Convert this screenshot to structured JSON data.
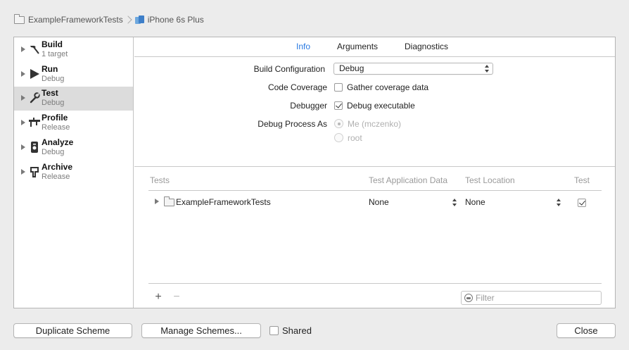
{
  "breadcrumb": {
    "project": "ExampleFrameworkTests",
    "device": "iPhone 6s Plus"
  },
  "sidebar": {
    "items": [
      {
        "name": "Build",
        "sub": "1 target",
        "icon": "hammer-icon",
        "selected": false
      },
      {
        "name": "Run",
        "sub": "Debug",
        "icon": "play-icon",
        "selected": false
      },
      {
        "name": "Test",
        "sub": "Debug",
        "icon": "wrench-icon",
        "selected": true
      },
      {
        "name": "Profile",
        "sub": "Release",
        "icon": "caliper-icon",
        "selected": false
      },
      {
        "name": "Analyze",
        "sub": "Debug",
        "icon": "analyze-icon",
        "selected": false
      },
      {
        "name": "Archive",
        "sub": "Release",
        "icon": "archive-icon",
        "selected": false
      }
    ]
  },
  "tabs": [
    {
      "label": "Info",
      "active": true
    },
    {
      "label": "Arguments",
      "active": false
    },
    {
      "label": "Diagnostics",
      "active": false
    }
  ],
  "form": {
    "build_config_label": "Build Configuration",
    "build_config_value": "Debug",
    "code_coverage_label": "Code Coverage",
    "code_coverage_option": "Gather coverage data",
    "code_coverage_checked": false,
    "debugger_label": "Debugger",
    "debugger_option": "Debug executable",
    "debugger_checked": true,
    "debug_process_label": "Debug Process As",
    "debug_process_options": [
      "Me (mczenko)",
      "root"
    ],
    "debug_process_selected": 0
  },
  "tests_table": {
    "headers": [
      "Tests",
      "Test Application Data",
      "Test Location",
      "Test"
    ],
    "rows": [
      {
        "name": "ExampleFrameworkTests",
        "app_data": "None",
        "location": "None",
        "enabled": true
      }
    ]
  },
  "toolbar": {
    "add_label": "+",
    "remove_label": "−",
    "filter_placeholder": "Filter"
  },
  "footer": {
    "duplicate_label": "Duplicate Scheme",
    "manage_label": "Manage Schemes...",
    "shared_label": "Shared",
    "shared_checked": false,
    "close_label": "Close"
  },
  "colors": {
    "accent": "#2a7ae2",
    "selected_row": "#dcdcdc",
    "window_bg": "#ececec"
  }
}
